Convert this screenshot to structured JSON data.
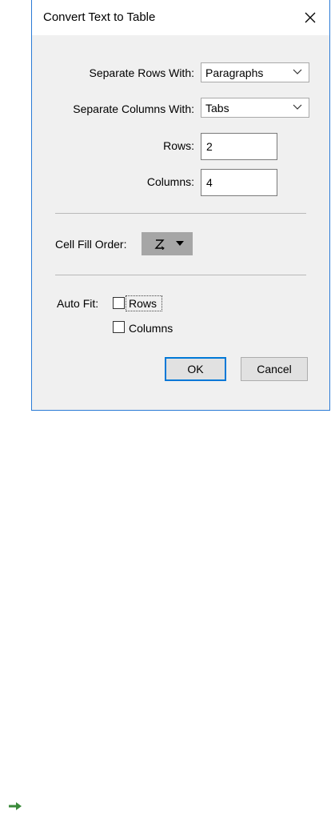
{
  "dialog": {
    "title": "Convert Text to Table",
    "close_icon": "close-icon",
    "rows_separator": {
      "label": "Separate Rows With:",
      "value": "Paragraphs"
    },
    "columns_separator": {
      "label": "Separate Columns With:",
      "value": "Tabs"
    },
    "rows": {
      "label": "Rows:",
      "value": "2"
    },
    "columns": {
      "label": "Columns:",
      "value": "4"
    },
    "cell_fill_order": {
      "label": "Cell Fill Order:",
      "icon": "z-order-icon"
    },
    "auto_fit": {
      "label": "Auto Fit:",
      "rows_label": "Rows",
      "rows_checked": false,
      "columns_label": "Columns",
      "columns_checked": false
    },
    "ok_label": "OK",
    "cancel_label": "Cancel"
  },
  "colors": {
    "accent": "#0078d7",
    "dialog_bg": "#f0f0f0",
    "fill_button_bg": "#a6a6a6",
    "arrow": "#3a8a3a"
  },
  "footer": {
    "arrow_icon": "green-right-arrow-icon"
  }
}
